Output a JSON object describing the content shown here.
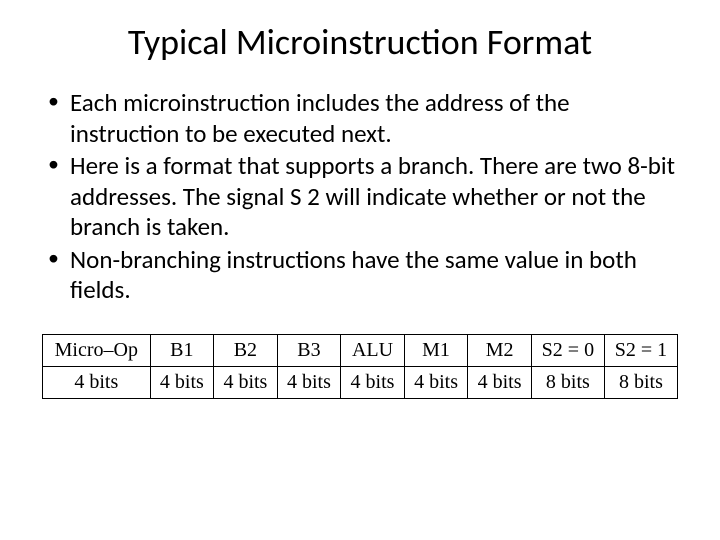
{
  "title": "Typical Microinstruction Format",
  "bullets": [
    "Each microinstruction includes the address of the instruction to be executed next.",
    "Here is a format that supports a branch. There are two 8-bit addresses.  The signal S 2 will indicate whether or not the branch is taken.",
    "Non-branching instructions have the same value in both fields."
  ],
  "table": {
    "headers": [
      "Micro–Op",
      "B1",
      "B2",
      "B3",
      "ALU",
      "M1",
      "M2",
      "S2 = 0",
      "S2 = 1"
    ],
    "row": [
      "4 bits",
      "4 bits",
      "4 bits",
      "4 bits",
      "4 bits",
      "4 bits",
      "4 bits",
      "8 bits",
      "8 bits"
    ]
  }
}
